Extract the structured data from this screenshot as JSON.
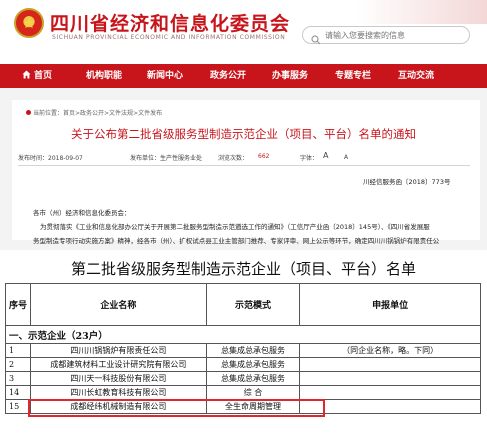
{
  "header": {
    "title": "四川省经济和信息化委员会",
    "subtitle": "SICHUAN PROVINCIAL ECONOMIC AND INFORMATION COMMISSION",
    "search_placeholder": "请输入您要搜索的信息"
  },
  "nav": {
    "items": [
      "首页",
      "机构职能",
      "新闻中心",
      "政务公开",
      "办事服务",
      "专题专栏",
      "互动交流"
    ]
  },
  "breadcrumb": "当前位置：首页>政务公开>文件法规>文件发布",
  "article": {
    "title": "关于公布第二批省级服务型制造示范企业（项目、平台）名单的通知",
    "publish_date": "发布时间：2018-09-07",
    "source": "发布单位：生产性服务业处",
    "views_label": "浏览次数：",
    "views": "662",
    "font_label": "字体：",
    "font_large": "A",
    "font_small": "A",
    "doc_number": "川经信服务函〔2018〕773号",
    "addressee": "各市（州）经济和信息化委员会：",
    "para1": "为贯彻落实《工业和信息化部办公厅关于开展第二批服务型制造示范遴选工作的通知》（工信厅产业函〔2018〕145号）、《四川省发展服",
    "para2": "务型制造专项行动实施方案》精神，经各市（州）、扩权试点县工业主管部门推荐、专家评审、网上公示等环节，确定四川川锅锅炉有限责任公"
  },
  "doc": {
    "title": "第二批省级服务型制造示范企业（项目、平台）名单",
    "headers": {
      "no": "序号",
      "name": "企业名称",
      "mode": "示范模式",
      "unit": "申报单位"
    },
    "group": "一、示范企业（23户）",
    "rows": [
      {
        "no": "1",
        "name": "四川川锅锅炉有限责任公司",
        "mode": "总集成总承包服务",
        "unit": "（同企业名称，略。下同）"
      },
      {
        "no": "2",
        "name": "成都建筑材料工业设计研究院有限公司",
        "mode": "总集成总承包服务",
        "unit": ""
      },
      {
        "no": "3",
        "name": "四川天一科技股份有限公司",
        "mode": "总集成总承包服务",
        "unit": ""
      },
      {
        "no": "14",
        "name": "四川长虹教育科技有限公司",
        "mode": "综 合",
        "unit": ""
      },
      {
        "no": "15",
        "name": "成都经纬机械制造有限公司",
        "mode": "全生命周期管理",
        "unit": ""
      }
    ]
  },
  "colors": {
    "brand_red": "#c8141b",
    "highlight_red": "#e0262e"
  },
  "icons": [
    "emblem-icon",
    "search-icon",
    "home-icon"
  ]
}
